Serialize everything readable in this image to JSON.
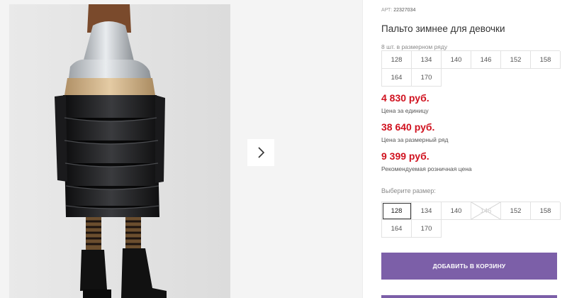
{
  "product": {
    "article_label": "АРТ:",
    "article_number": "22327034",
    "title": "Пальто зимнее для девочки",
    "pack_label": "8 шт. в размерном ряду",
    "pack_sizes": [
      "128",
      "134",
      "140",
      "146",
      "152",
      "158",
      "164",
      "170"
    ]
  },
  "prices": [
    {
      "amount": "4 830 руб.",
      "note": "Цена за единицу"
    },
    {
      "amount": "38 640 руб.",
      "note": "Цена за размерный ряд"
    },
    {
      "amount": "9 399 руб.",
      "note": "Рекомендуемая розничная цена"
    }
  ],
  "size_selector": {
    "label": "Выберите размер:",
    "sizes": [
      {
        "value": "128",
        "state": "selected"
      },
      {
        "value": "134",
        "state": "available"
      },
      {
        "value": "140",
        "state": "available"
      },
      {
        "value": "146",
        "state": "unavailable"
      },
      {
        "value": "152",
        "state": "available"
      },
      {
        "value": "158",
        "state": "available"
      },
      {
        "value": "164",
        "state": "available"
      },
      {
        "value": "170",
        "state": "available"
      }
    ]
  },
  "actions": {
    "add_to_cart": "ДОБАВИТЬ В КОРЗИНУ"
  },
  "gallery": {
    "next_icon": "chevron-right-icon"
  },
  "colors": {
    "accent": "#7c5fa8",
    "price": "#d0121f"
  }
}
